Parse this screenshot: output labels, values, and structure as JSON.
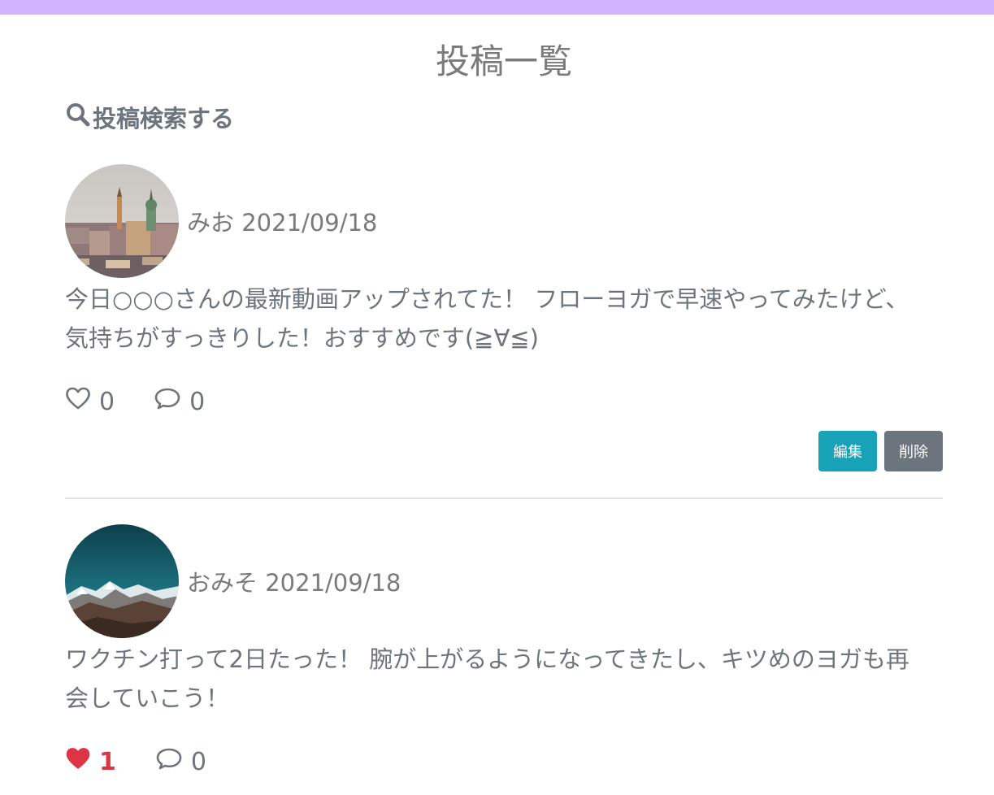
{
  "colors": {
    "topbar": "#d1b3ff",
    "edit_button": "#17a2b8",
    "delete_button": "#6c757d",
    "liked_heart": "#dc3545",
    "text": "#6c757d"
  },
  "page": {
    "title": "投稿一覧",
    "search_label": "投稿検索する",
    "search_icon": "search-icon"
  },
  "posts": [
    {
      "username": "みお",
      "date": "2021/09/18",
      "body": "今日○○○さんの最新動画アップされてた！ フローヨガで早速やってみたけど、気持ちがすっきりした！おすすめです(≧∀≦)",
      "likes": "0",
      "comments": "0",
      "liked": false,
      "like_icon": "heart-outline-icon",
      "comment_icon": "chat-bubble-icon",
      "avatar": "city-skyline-avatar",
      "edit_label": "編集",
      "delete_label": "削除"
    },
    {
      "username": "おみそ",
      "date": "2021/09/18",
      "body": "ワクチン打って2日たった！ 腕が上がるようになってきたし、キツめのヨガも再会していこう！",
      "likes": "1",
      "comments": "0",
      "liked": true,
      "like_icon": "heart-filled-icon",
      "comment_icon": "chat-bubble-icon",
      "avatar": "mountain-avatar"
    }
  ]
}
